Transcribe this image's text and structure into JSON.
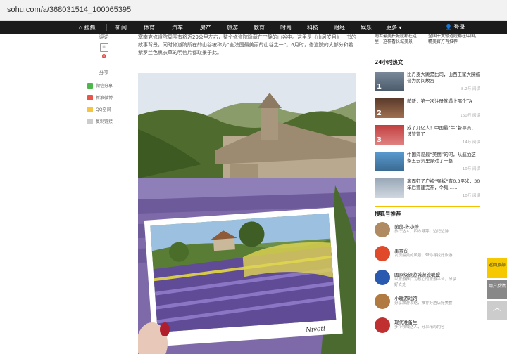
{
  "browser": {
    "url": "sohu.com/a/368031514_100065395"
  },
  "nav": {
    "home": "⌂ 搜狐",
    "items": [
      "新闻",
      "体育",
      "汽车",
      "房产",
      "旅游",
      "教育",
      "时尚",
      "科技",
      "财经",
      "娱乐",
      "更多 ▾"
    ],
    "login": "登录"
  },
  "left_rail": {
    "comment_label": "评论",
    "comment_count": "0",
    "share_label": "分享",
    "share_items": [
      "微信分享",
      "新浪微博",
      "QQ空间",
      "复制链接"
    ]
  },
  "article": {
    "para": "塞南克修道院周围有将近29公里左右，整个修道院隐藏在宁静的山谷中。这里是《山居岁月》一书的故事背景，同时修道院所在的山谷被称为“全法国最美丽的山谷之一”。6月时，修道院的大部分和着紫罗兰色熏衣草的明信片都取景于此。"
  },
  "right": {
    "top_captions": [
      "雨若最美长城段都在这里！这样看长城美景",
      "全国十大修道院都在中国，精美官方有推荐"
    ],
    "hot_title": "24小时热文",
    "hot": [
      {
        "title": "比丹麦大跳是比司，山西王家大院被誉为民间故宫",
        "meta": "8.2万 阅读"
      },
      {
        "title": "萌新：第一次注册就遇上那个TA",
        "meta": "160万 阅读"
      },
      {
        "title": "成了几亿人！中国最“牛”督导员，该管管了",
        "meta": "14万 阅读"
      },
      {
        "title": "中国海岛最“美丽”的河，从航拍这条五云洞里穿过了一整……",
        "meta": "10万 阅读"
      },
      {
        "title": "离面钉子户被“强拆”有0.3平米，30年后要建完神，令鬼……",
        "meta": "10万 阅读"
      }
    ],
    "mp_title": "搜狐号推荐",
    "mp": [
      {
        "name": "茵茵-陈小绮",
        "desc": "旅行达人，四方寻踪，边记边游"
      },
      {
        "name": "墨青谷",
        "desc": "发现最美的风景，带你寻找好旅游"
      },
      {
        "name": "国家级旅游城游旅联盟",
        "desc": "以旅游推广为核心的旅游平台，分享好去处"
      },
      {
        "name": "小暖游戏馆",
        "desc": "分享旅游攻略，推荐好酒店好美食"
      },
      {
        "name": "现代准备生",
        "desc": "多个领域达人，分享精彩内容"
      }
    ]
  },
  "float": {
    "back_top": "返回顶部",
    "feedback": "用户反馈"
  }
}
